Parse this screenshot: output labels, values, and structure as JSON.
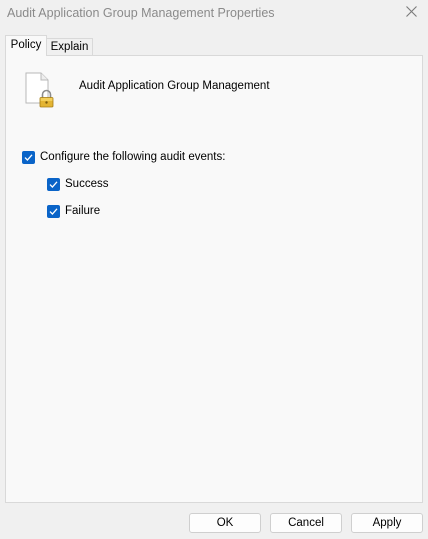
{
  "window": {
    "title": "Audit Application Group Management Properties"
  },
  "tabs": [
    {
      "label": "Policy",
      "active": true
    },
    {
      "label": "Explain",
      "active": false
    }
  ],
  "policy": {
    "name": "Audit Application Group Management",
    "icon": "locked-document-icon"
  },
  "options": {
    "configure": {
      "label": "Configure the following audit events:",
      "checked": true
    },
    "success": {
      "label": "Success",
      "checked": true
    },
    "failure": {
      "label": "Failure",
      "checked": true
    }
  },
  "buttons": {
    "ok": "OK",
    "cancel": "Cancel",
    "apply": "Apply"
  },
  "colors": {
    "accent": "#0a64c8",
    "window_bg": "#f0f0f0",
    "panel_bg": "#f9f9f9"
  }
}
